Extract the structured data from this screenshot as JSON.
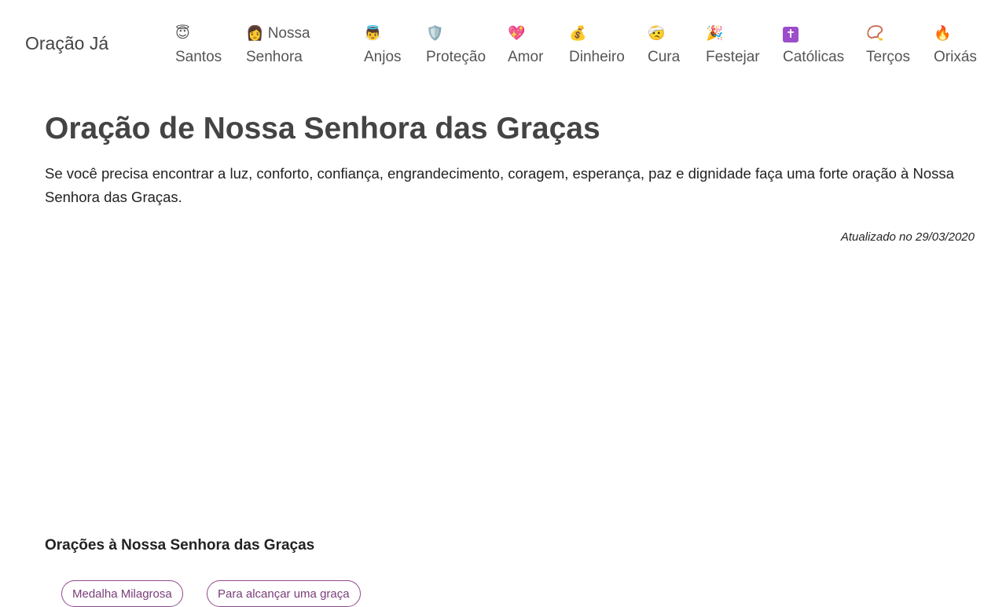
{
  "header": {
    "logo": "Oração Já",
    "nav": [
      {
        "icon": "😇",
        "icon_name": "halo-face-icon",
        "label": "Santos"
      },
      {
        "icon": "👩",
        "icon_name": "woman-icon",
        "label_top": "Nossa",
        "label": "Senhora"
      },
      {
        "icon": "👼",
        "icon_name": "angel-icon",
        "label": "Anjos"
      },
      {
        "icon": "🛡️",
        "icon_name": "shield-icon",
        "label": "Proteção"
      },
      {
        "icon": "💖",
        "icon_name": "sparkling-heart-icon",
        "label": "Amor"
      },
      {
        "icon": "💰",
        "icon_name": "money-bag-icon",
        "label": "Dinheiro"
      },
      {
        "icon": "🤕",
        "icon_name": "bandaged-face-icon",
        "label": "Cura"
      },
      {
        "icon": "🎉",
        "icon_name": "party-popper-icon",
        "label": "Festejar"
      },
      {
        "icon": "✝",
        "icon_name": "latin-cross-icon",
        "label": "Católicas"
      },
      {
        "icon": "📿",
        "icon_name": "rosary-icon",
        "label": "Terços"
      },
      {
        "icon": "🔥",
        "icon_name": "fire-icon",
        "label": "Orixás"
      }
    ]
  },
  "article": {
    "title": "Oração de Nossa Senhora das Graças",
    "intro": "Se você precisa encontrar a luz, conforto, confiança, engrandecimento, coragem, esperança, paz e dignidade faça uma forte oração à Nossa Senhora das Graças.",
    "updated": "Atualizado no 29/03/2020"
  },
  "related": {
    "heading": "Orações à Nossa Senhora das Graças",
    "tags": [
      "Medalha Milagrosa",
      "Para alcançar uma graça"
    ]
  },
  "colors": {
    "text": "#333333",
    "tag_border": "#8e4a8e",
    "tag_text": "#7a3d7a"
  }
}
